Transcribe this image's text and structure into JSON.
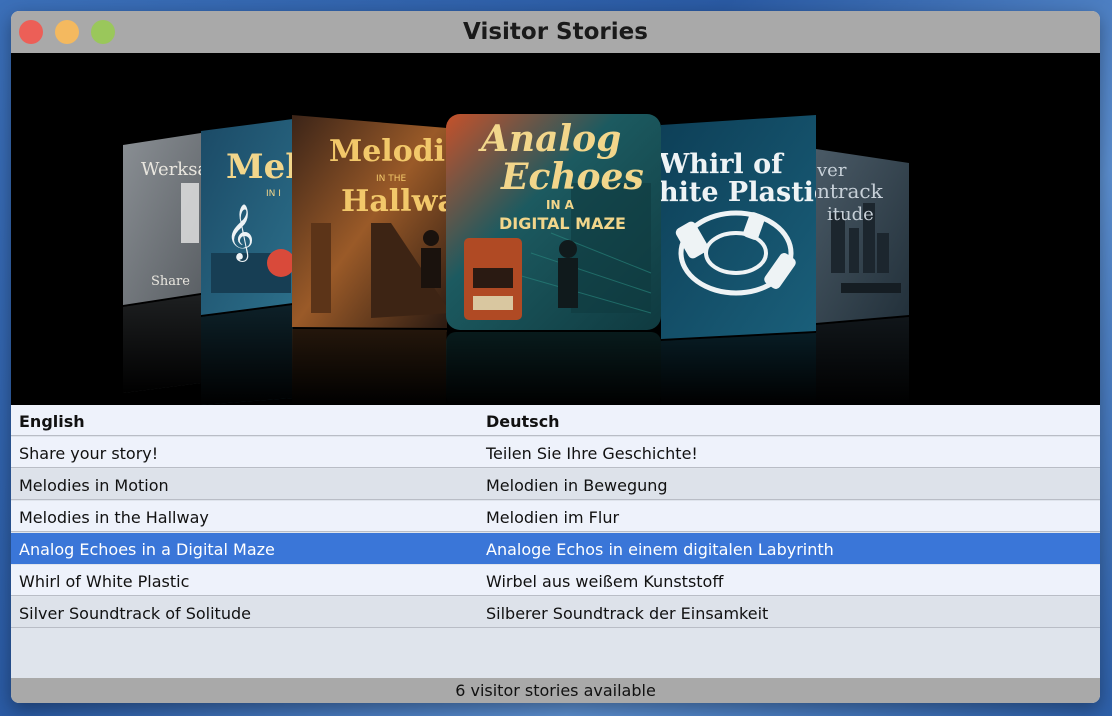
{
  "window": {
    "title": "Visitor Stories"
  },
  "covers": [
    {
      "title_lines": [
        "Werksa",
        "Share"
      ],
      "bg": "#6e7378",
      "accent": "#e9e6df"
    },
    {
      "title_lines": [
        "Mel",
        "IN I"
      ],
      "bg": "#1f5a7a",
      "accent": "#f2d68b"
    },
    {
      "title_lines": [
        "Melodies",
        "IN THE",
        "Hallway"
      ],
      "bg": "#7a4b26",
      "accent": "#f2c86a"
    },
    {
      "title_lines": [
        "Analog",
        "Echoes",
        "IN A",
        "DIGITAL MAZE"
      ],
      "bg": "#1d5a5f",
      "accent": "#f2d68b"
    },
    {
      "title_lines": [
        "Whirl of",
        "hite Plastic"
      ],
      "bg": "#0f4a63",
      "accent": "#eef3f5"
    },
    {
      "title_lines": [
        "ver",
        "ntrack",
        "itude"
      ],
      "bg": "#374956",
      "accent": "#c7d0d8"
    }
  ],
  "table": {
    "columns": [
      "English",
      "Deutsch"
    ],
    "rows": [
      {
        "english": "Share your story!",
        "deutsch": "Teilen Sie Ihre Geschichte!"
      },
      {
        "english": "Melodies in Motion",
        "deutsch": "Melodien in Bewegung"
      },
      {
        "english": "Melodies in the Hallway",
        "deutsch": "Melodien im Flur"
      },
      {
        "english": "Analog Echoes in a Digital Maze",
        "deutsch": "Analoge Echos in einem digitalen Labyrinth"
      },
      {
        "english": "Whirl of White Plastic",
        "deutsch": "Wirbel aus weißem Kunststoff"
      },
      {
        "english": "Silver Soundtrack of Solitude",
        "deutsch": "Silberer Soundtrack der Einsamkeit"
      }
    ],
    "selected_index": 3
  },
  "status": {
    "text": "6 visitor stories available"
  },
  "colors": {
    "selection": "#3a76d8",
    "titlebar": "#a9a9a9"
  }
}
